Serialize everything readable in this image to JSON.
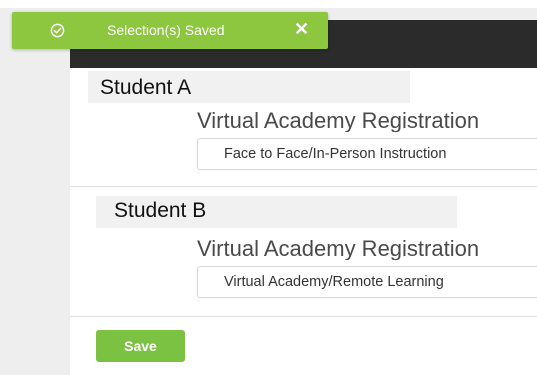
{
  "toast": {
    "message": "Selection(s) Saved",
    "close_glyph": "✕",
    "icon": "check-circle-icon",
    "color": "#8dc63f"
  },
  "students": [
    {
      "name": "Student A",
      "registration_label": "Virtual Academy Registration",
      "selected_option": "Face to Face/In-Person Instruction"
    },
    {
      "name": "Student B",
      "registration_label": "Virtual Academy Registration",
      "selected_option": "Virtual Academy/Remote Learning"
    }
  ],
  "actions": {
    "save_label": "Save",
    "save_color": "#7cc242"
  },
  "colors": {
    "header": "#2b2b2b",
    "background": "#eeeeee"
  }
}
